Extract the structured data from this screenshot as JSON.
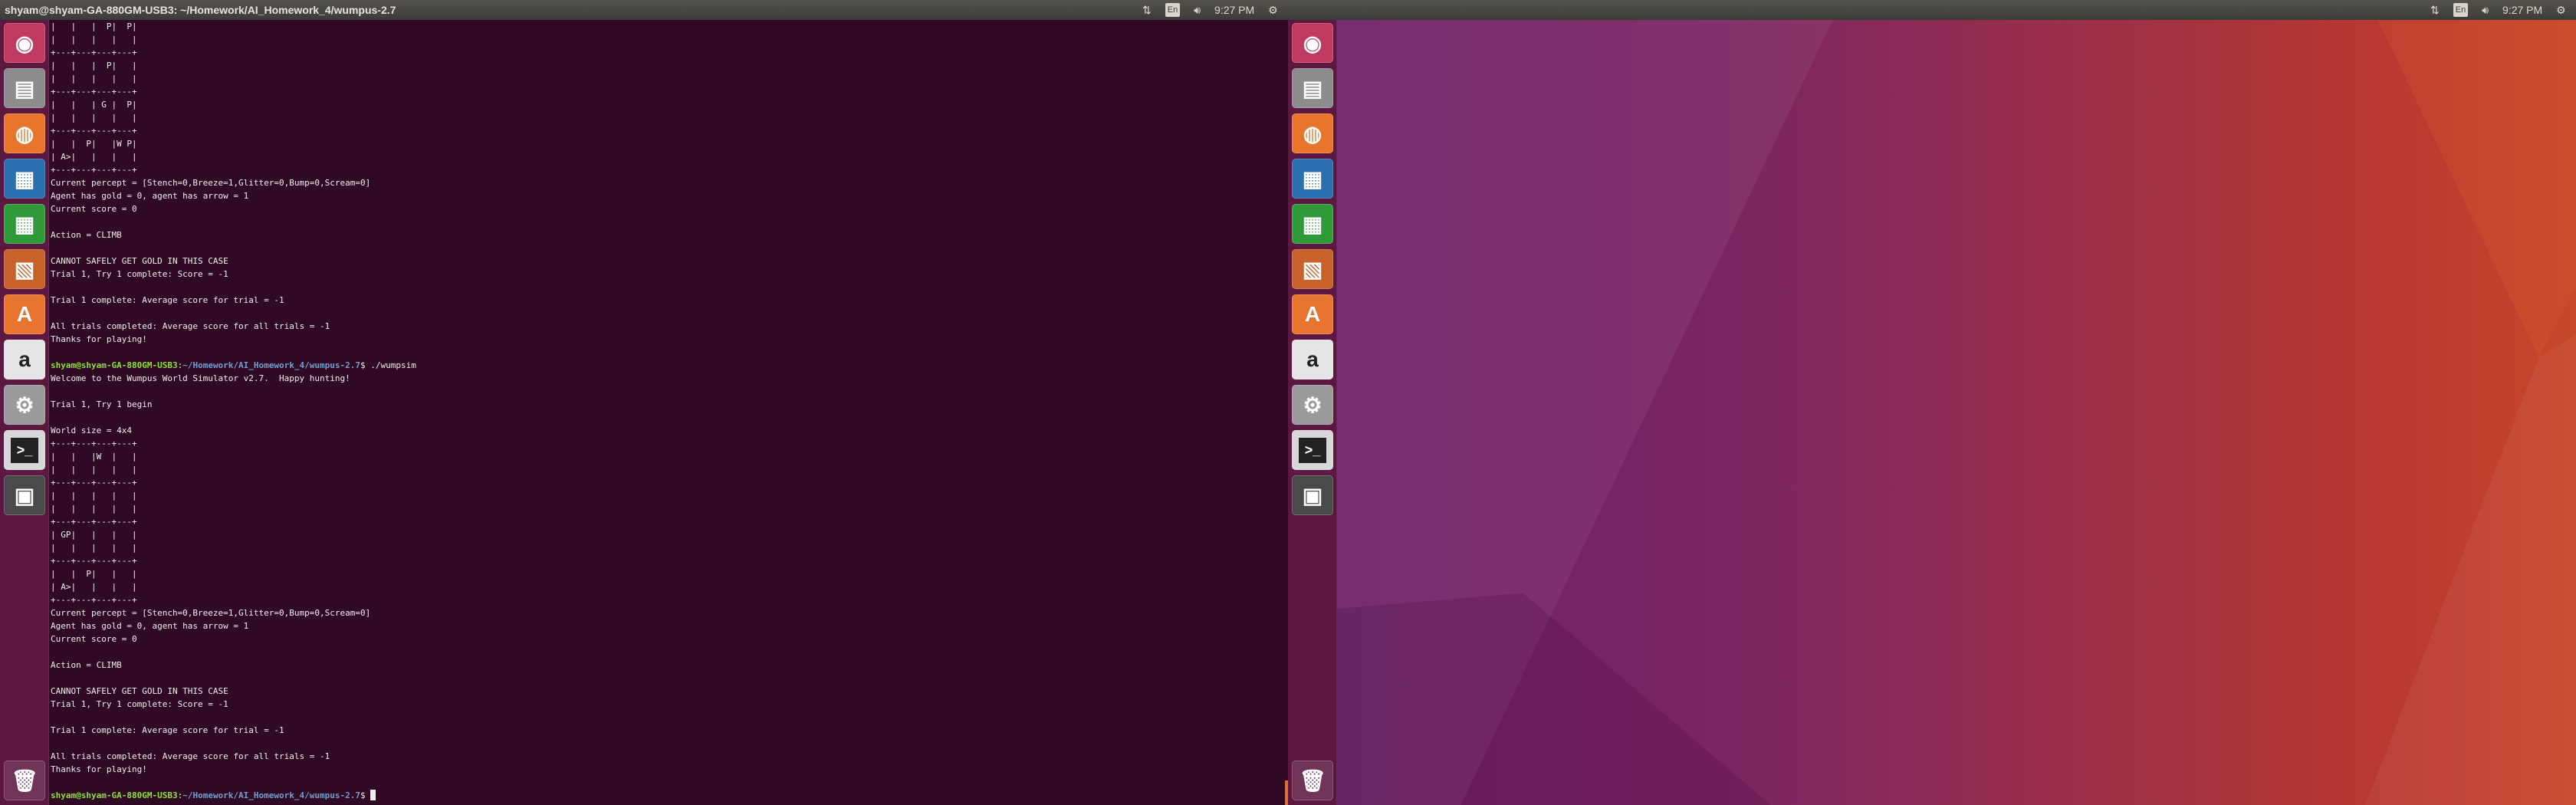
{
  "topbar_left": {
    "title": "shyam@shyam-GA-880GM-USB3: ~/Homework/AI_Homework_4/wumpus-2.7",
    "keyboard": "En",
    "clock": "9:27 PM"
  },
  "topbar_right": {
    "keyboard": "En",
    "clock": "9:27 PM"
  },
  "launcher": [
    {
      "name": "ubuntu-dash",
      "glyph": "◉",
      "color": "#c0395f"
    },
    {
      "name": "files",
      "glyph": "▤",
      "color": "#8c8c8c"
    },
    {
      "name": "firefox",
      "glyph": "◍",
      "color": "#e8732a"
    },
    {
      "name": "libreoffice-writer",
      "glyph": "▦",
      "color": "#2a6fb0"
    },
    {
      "name": "libreoffice-calc",
      "glyph": "▦",
      "color": "#2f9a3a"
    },
    {
      "name": "libreoffice-impress",
      "glyph": "▧",
      "color": "#c8612a"
    },
    {
      "name": "software-center",
      "glyph": "A",
      "color": "#e8752f"
    },
    {
      "name": "amazon",
      "glyph": "a",
      "color": "#e5e5e5"
    },
    {
      "name": "system-settings",
      "glyph": "⚙",
      "color": "#9a9a9a"
    },
    {
      "name": "terminal",
      "glyph": ">_",
      "color": "#2b2b2b"
    },
    {
      "name": "save-disk",
      "glyph": "▣",
      "color": "#4a4a4a"
    }
  ],
  "trash": {
    "name": "trash",
    "glyph": "🗑"
  },
  "terminal": {
    "lines": [
      "|   |   |  P|  P|",
      "|   |   |   |   |",
      "+---+---+---+---+",
      "|   |   |  P|   |",
      "|   |   |   |   |",
      "+---+---+---+---+",
      "|   |   | G |  P|",
      "|   |   |   |   |",
      "+---+---+---+---+",
      "|   |  P|   |W P|",
      "| A>|   |   |   |",
      "+---+---+---+---+",
      "Current percept = [Stench=0,Breeze=1,Glitter=0,Bump=0,Scream=0]",
      "Agent has gold = 0, agent has arrow = 1",
      "Current score = 0",
      "",
      "Action = CLIMB",
      "",
      "CANNOT SAFELY GET GOLD IN THIS CASE",
      "Trial 1, Try 1 complete: Score = -1",
      "",
      "Trial 1 complete: Average score for trial = -1",
      "",
      "All trials completed: Average score for all trials = -1",
      "Thanks for playing!",
      "",
      {
        "user": "shyam@shyam-GA-880GM-USB3",
        "path": "~/Homework/AI_Homework_4/wumpus-2.7",
        "cmd": " ./wumpsim"
      },
      "Welcome to the Wumpus World Simulator v2.7.  Happy hunting!",
      "",
      "Trial 1, Try 1 begin",
      "",
      "World size = 4x4",
      "+---+---+---+---+",
      "|   |   |W  |   |",
      "|   |   |   |   |",
      "+---+---+---+---+",
      "|   |   |   |   |",
      "|   |   |   |   |",
      "+---+---+---+---+",
      "| GP|   |   |   |",
      "|   |   |   |   |",
      "+---+---+---+---+",
      "|   |  P|   |   |",
      "| A>|   |   |   |",
      "+---+---+---+---+",
      "Current percept = [Stench=0,Breeze=1,Glitter=0,Bump=0,Scream=0]",
      "Agent has gold = 0, agent has arrow = 1",
      "Current score = 0",
      "",
      "Action = CLIMB",
      "",
      "CANNOT SAFELY GET GOLD IN THIS CASE",
      "Trial 1, Try 1 complete: Score = -1",
      "",
      "Trial 1 complete: Average score for trial = -1",
      "",
      "All trials completed: Average score for all trials = -1",
      "Thanks for playing!",
      "",
      {
        "user": "shyam@shyam-GA-880GM-USB3",
        "path": "~/Homework/AI_Homework_4/wumpus-2.7",
        "cmd": " ",
        "cursor": true
      }
    ]
  }
}
